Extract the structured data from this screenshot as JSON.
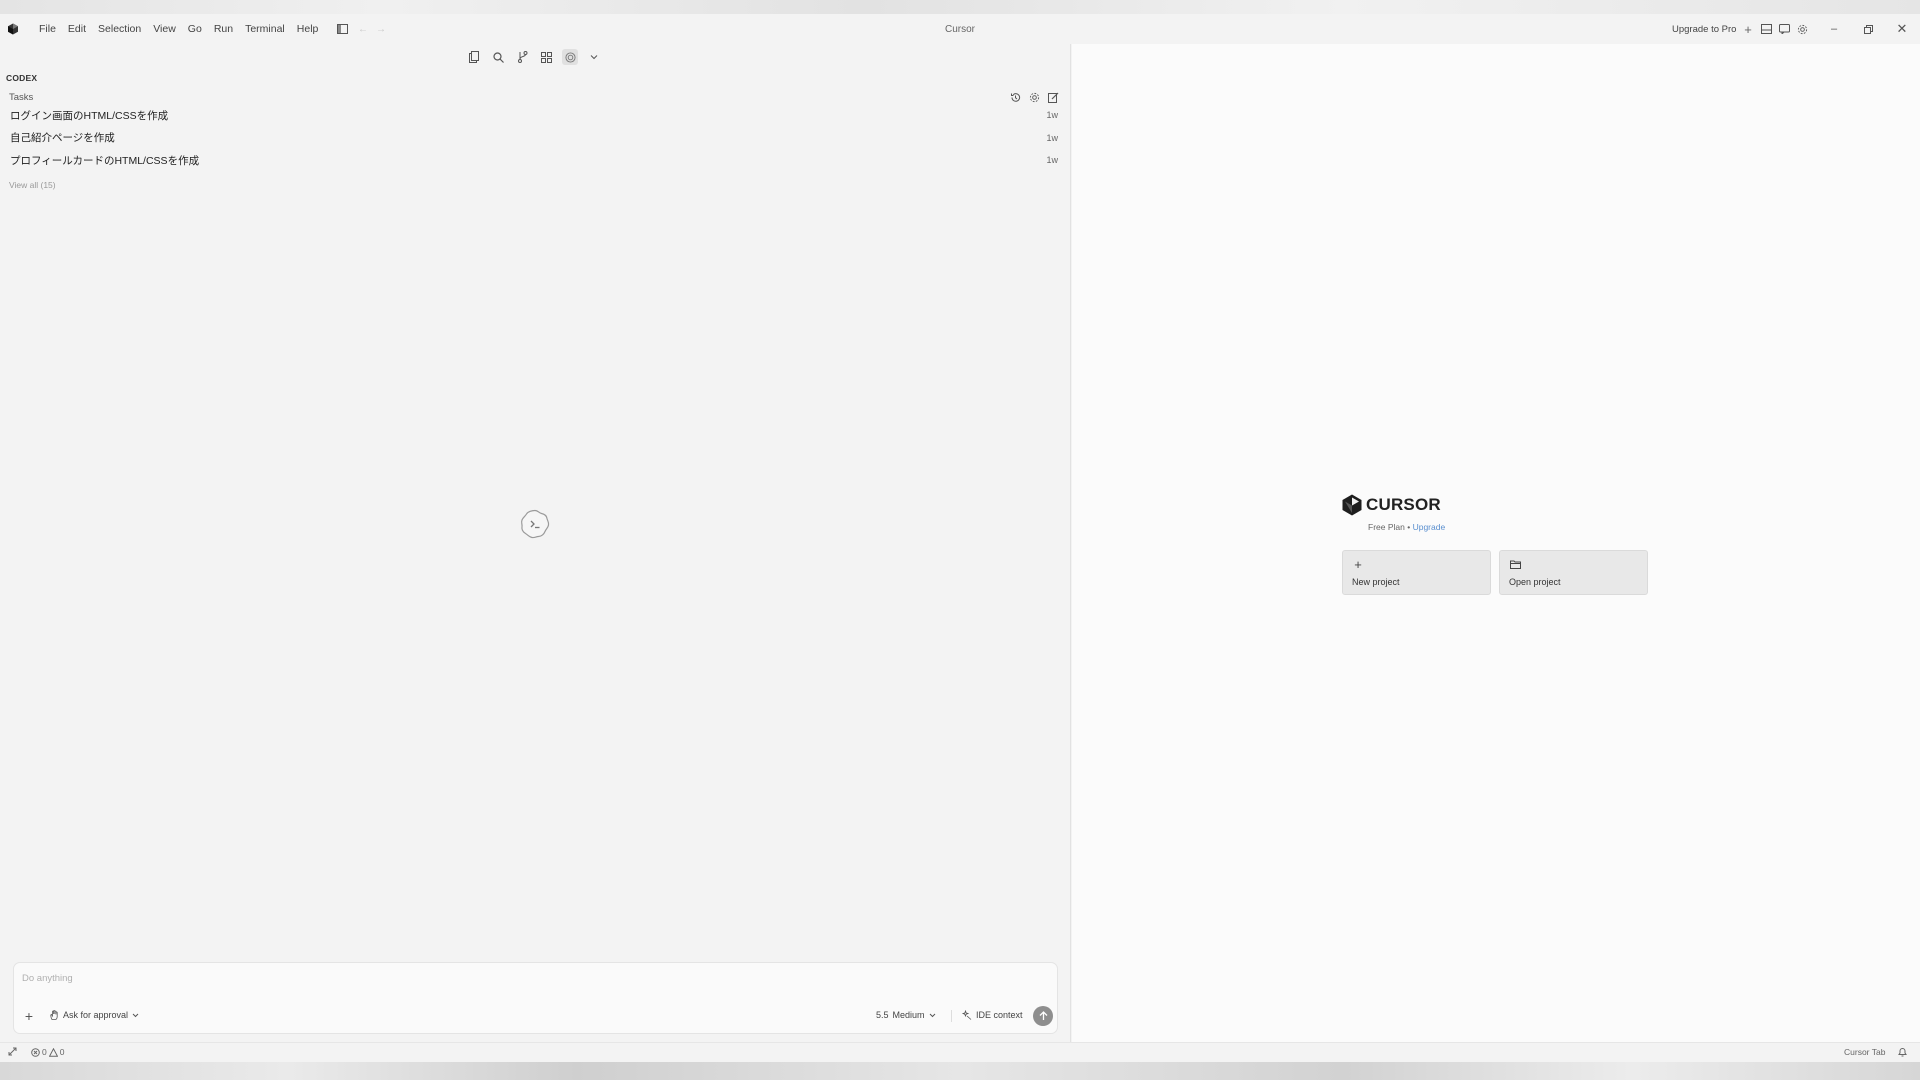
{
  "titlebar": {
    "title": "Cursor",
    "menu": [
      "File",
      "Edit",
      "Selection",
      "View",
      "Go",
      "Run",
      "Terminal",
      "Help"
    ],
    "upgrade_label": "Upgrade to Pro"
  },
  "codex": {
    "section_label": "CODEX",
    "tasks_label": "Tasks",
    "tasks": [
      {
        "title": "ログイン画面のHTML/CSSを作成",
        "age": "1w"
      },
      {
        "title": "自己紹介ページを作成",
        "age": "1w"
      },
      {
        "title": "プロフィールカードのHTML/CSSを作成",
        "age": "1w"
      }
    ],
    "view_all": "View all (15)"
  },
  "composer": {
    "placeholder": "Do anything",
    "approval_label": "Ask for approval",
    "model_version": "5.5",
    "model_effort": "Medium",
    "context_label": "IDE context"
  },
  "welcome": {
    "brand": "CURSOR",
    "plan": "Free Plan",
    "separator": "•",
    "upgrade_link": "Upgrade",
    "new_project": "New project",
    "open_project": "Open project"
  },
  "statusbar": {
    "errors": "0",
    "warnings": "0",
    "right_label": "Cursor Tab"
  },
  "colors": {
    "panel_bg": "#f3f3f3",
    "editor_bg": "#fbfbfb",
    "link": "#5a8fcf",
    "send_button": "#8e8e8e"
  }
}
